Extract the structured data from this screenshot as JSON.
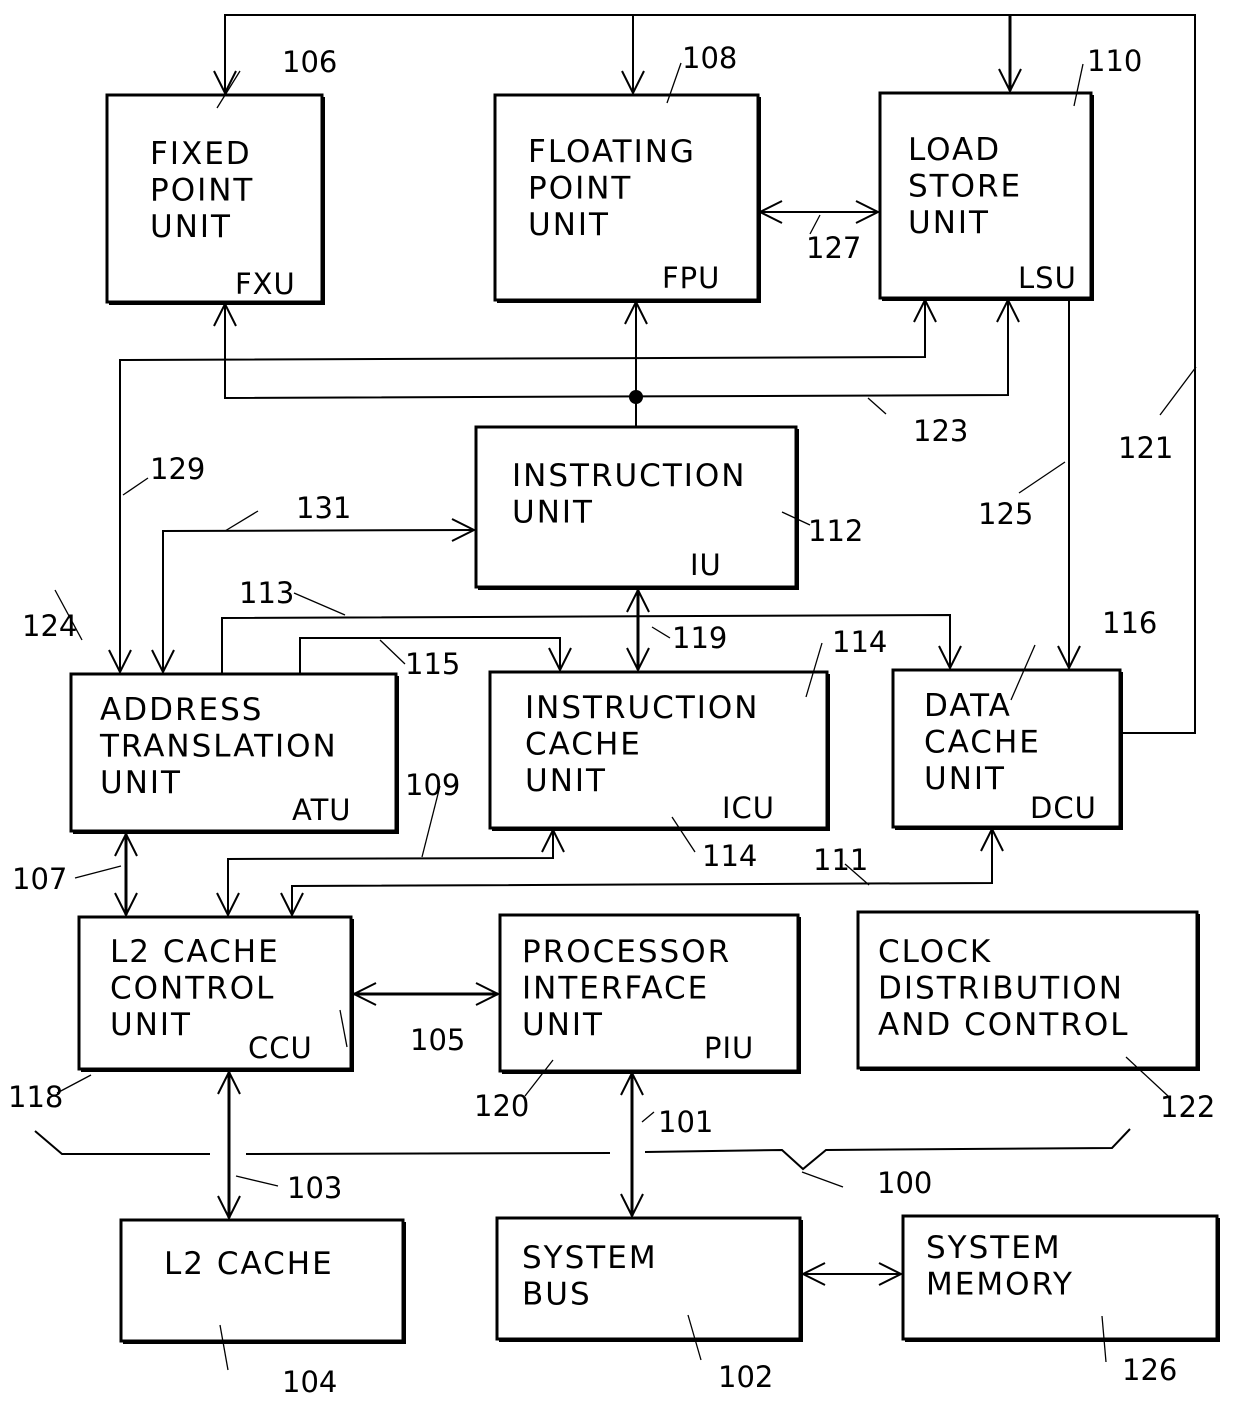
{
  "figure": {
    "type": "processor block diagram",
    "processor_ref": "100"
  },
  "blocks": [
    {
      "id": "fxu",
      "ref": "106",
      "lines": [
        "FIXED",
        "POINT",
        "UNIT"
      ],
      "abbr": "FXU"
    },
    {
      "id": "fpu",
      "ref": "108",
      "lines": [
        "FLOATING",
        "POINT",
        "UNIT"
      ],
      "abbr": "FPU"
    },
    {
      "id": "lsu",
      "ref": "110",
      "lines": [
        "LOAD",
        "STORE",
        "UNIT"
      ],
      "abbr": "LSU"
    },
    {
      "id": "iu",
      "ref": "112",
      "lines": [
        "INSTRUCTION",
        "UNIT"
      ],
      "abbr": "IU"
    },
    {
      "id": "atu",
      "ref": "124",
      "lines": [
        "ADDRESS",
        "TRANSLATION",
        "UNIT"
      ],
      "abbr": "ATU"
    },
    {
      "id": "icu",
      "ref": "114",
      "lines": [
        "INSTRUCTION",
        "CACHE",
        "UNIT"
      ],
      "abbr": "ICU"
    },
    {
      "id": "dcu",
      "ref": "116",
      "lines": [
        "DATA",
        "CACHE",
        "UNIT"
      ],
      "abbr": "DCU"
    },
    {
      "id": "ccu",
      "ref": "118",
      "lines": [
        "L2 CACHE",
        "CONTROL",
        "UNIT"
      ],
      "abbr": "CCU"
    },
    {
      "id": "piu",
      "ref": "120",
      "lines": [
        "PROCESSOR",
        "INTERFACE",
        "UNIT"
      ],
      "abbr": "PIU"
    },
    {
      "id": "clock",
      "ref": "122",
      "lines": [
        "CLOCK",
        "DISTRIBUTION",
        "AND  CONTROL"
      ],
      "abbr": ""
    },
    {
      "id": "l2",
      "ref": "104",
      "lines": [
        "L2  CACHE"
      ],
      "abbr": ""
    },
    {
      "id": "bus",
      "ref": "102",
      "lines": [
        "SYSTEM",
        "BUS"
      ],
      "abbr": ""
    },
    {
      "id": "mem",
      "ref": "126",
      "lines": [
        "SYSTEM",
        "MEMORY"
      ],
      "abbr": ""
    }
  ],
  "connections": [
    {
      "ref": "101",
      "from": "piu",
      "to": "bus",
      "direction": "bidirectional"
    },
    {
      "ref": "103",
      "from": "ccu",
      "to": "l2",
      "direction": "bidirectional"
    },
    {
      "ref": "105",
      "from": "ccu",
      "to": "piu",
      "direction": "bidirectional"
    },
    {
      "ref": "107",
      "from": "atu",
      "to": "ccu",
      "direction": "bidirectional"
    },
    {
      "ref": "109",
      "from": "icu",
      "to": "ccu",
      "direction": "bidirectional"
    },
    {
      "ref": "111",
      "from": "dcu",
      "to": "ccu",
      "direction": "bidirectional"
    },
    {
      "ref": "113",
      "from": "atu",
      "to": "dcu",
      "direction": "to"
    },
    {
      "ref": "115",
      "from": "atu",
      "to": "icu",
      "direction": "to"
    },
    {
      "ref": "119",
      "from": "iu",
      "to": "icu",
      "direction": "bidirectional"
    },
    {
      "ref": "121",
      "from": "dcu",
      "to": "fxu,fpu,lsu",
      "direction": "to"
    },
    {
      "ref": "123",
      "from": "iu",
      "to": "fxu,fpu,lsu",
      "direction": "to"
    },
    {
      "ref": "125",
      "from": "lsu",
      "to": "dcu",
      "direction": "to"
    },
    {
      "ref": "127",
      "from": "fpu",
      "to": "lsu",
      "direction": "bidirectional"
    },
    {
      "ref": "129",
      "from": "lsu",
      "to": "atu",
      "direction": "to"
    },
    {
      "ref": "131",
      "from": "atu",
      "to": "iu",
      "direction": "to"
    },
    {
      "ref": "",
      "from": "bus",
      "to": "mem",
      "direction": "bidirectional"
    }
  ],
  "reference_labels": {
    "r100": "100",
    "r101": "101",
    "r102": "102",
    "r103": "103",
    "r104": "104",
    "r105": "105",
    "r106": "106",
    "r107": "107",
    "r108": "108",
    "r109": "109",
    "r110": "110",
    "r111": "111",
    "r112": "112",
    "r113": "113",
    "r114a": "114",
    "r114b": "114",
    "r115": "115",
    "r116": "116",
    "r118": "118",
    "r119": "119",
    "r120": "120",
    "r121": "121",
    "r122": "122",
    "r123": "123",
    "r124": "124",
    "r125": "125",
    "r126": "126",
    "r127": "127",
    "r129": "129",
    "r131": "131"
  }
}
